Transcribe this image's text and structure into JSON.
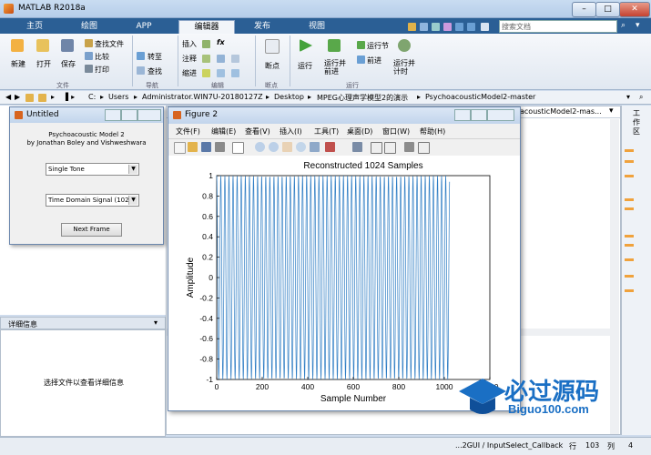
{
  "app": {
    "title": "MATLAB R2018a",
    "window_buttons": [
      "–",
      "□",
      "✕"
    ]
  },
  "tabs": [
    {
      "label": "主页"
    },
    {
      "label": "绘图"
    },
    {
      "label": "APP"
    },
    {
      "label": "编辑器"
    },
    {
      "label": "发布"
    },
    {
      "label": "视图"
    }
  ],
  "search": {
    "placeholder": "搜索文档"
  },
  "ribbon": {
    "file": {
      "new": "新建",
      "open": "打开",
      "save": "保存",
      "find_files": "查找文件",
      "compare": "比较",
      "print": "打印",
      "group": "文件"
    },
    "navigate": {
      "goto": "转至",
      "find": "查找",
      "group": "导航"
    },
    "edit": {
      "insert": "插入",
      "comment": "注释",
      "indent": "缩进",
      "fx": "fx",
      "group": "编辑"
    },
    "breakpoints": {
      "label": "断点",
      "group": "断点"
    },
    "run": {
      "run": "运行",
      "run_advance": "运行并\n前进",
      "run_section": "运行节",
      "advance": "前进",
      "run_time": "运行并\n计时",
      "group": "运行"
    }
  },
  "address": {
    "segments": [
      "C:",
      "Users",
      "Administrator.WIN7U-20180127Z",
      "Desktop",
      "MPEG心理声学模型2的演示",
      "PsychoacousticModel2-master"
    ]
  },
  "untitled_window": {
    "title": "Untitled",
    "heading_line1": "Psychoacoustic Model 2",
    "heading_line2": "by Jonathan Boley and Vishweshwara",
    "select1": "Single Tone",
    "select2": "Time Domain Signal (102...",
    "button": "Next Frame"
  },
  "figure_window": {
    "title": "Figure 2",
    "menu": [
      "文件(F)",
      "编辑(E)",
      "查看(V)",
      "插入(I)",
      "工具(T)",
      "桌面(D)",
      "窗口(W)",
      "帮助(H)"
    ]
  },
  "editor_tab_partial": "acousticModel2-mas...",
  "right_panel_label": "工作区",
  "details": {
    "header": "详细信息",
    "placeholder": "选择文件以查看详细信息"
  },
  "status": {
    "function": "...2GUI / InputSelect_Callback",
    "row_label": "行",
    "row": "103",
    "col_label": "列",
    "col": "4"
  },
  "watermark": {
    "main": "必过源码",
    "sub": "Biguo100.com"
  },
  "chart_data": {
    "type": "line",
    "title": "Reconstructed 1024 Samples",
    "xlabel": "Sample Number",
    "ylabel": "Amplitude",
    "xlim": [
      0,
      1200
    ],
    "ylim": [
      -1,
      1
    ],
    "xticks": [
      0,
      200,
      400,
      600,
      800,
      1000,
      1200
    ],
    "yticks": [
      -1,
      -0.8,
      -0.6,
      -0.4,
      -0.2,
      0,
      0.2,
      0.4,
      0.6,
      0.8,
      1
    ],
    "series": [
      {
        "color": "#2e7dc4",
        "n_samples": 1024,
        "amplitude": 1,
        "cycles": 57
      }
    ],
    "grid": false
  }
}
